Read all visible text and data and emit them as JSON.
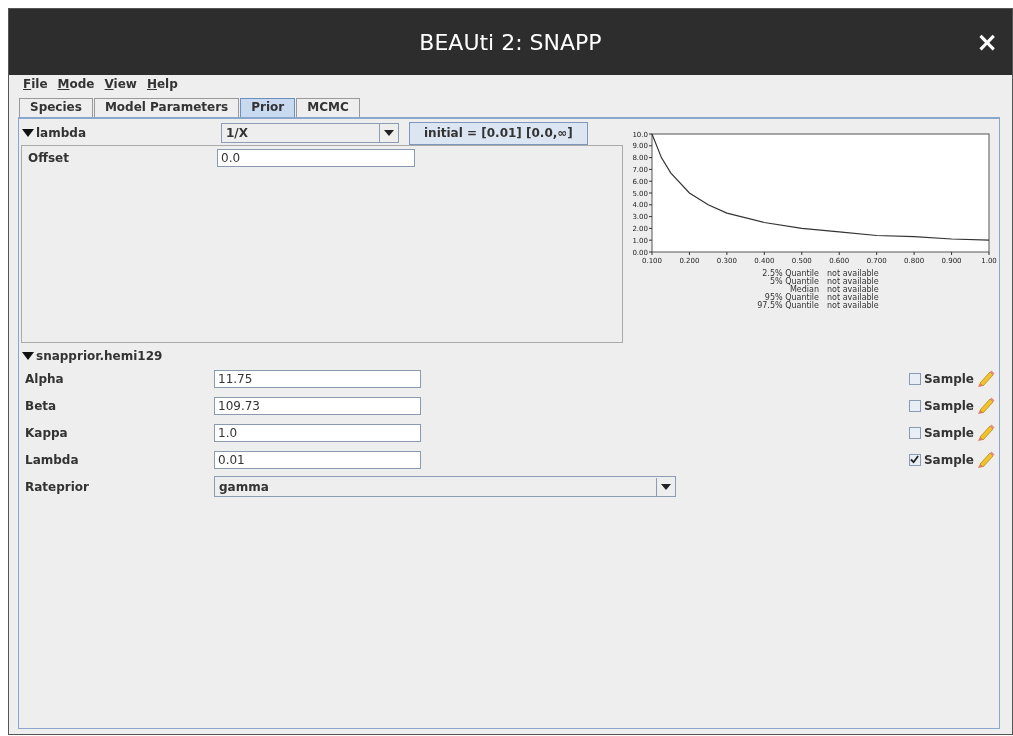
{
  "window": {
    "title": "BEAUti 2: SNAPP",
    "close": "×"
  },
  "menu": [
    "File",
    "Mode",
    "View",
    "Help"
  ],
  "tabs": [
    {
      "label": "Species",
      "selected": false
    },
    {
      "label": "Model Parameters",
      "selected": false
    },
    {
      "label": "Prior",
      "selected": true
    },
    {
      "label": "MCMC",
      "selected": false
    }
  ],
  "prior": {
    "name": "lambda",
    "expanded": true,
    "distribution": "1/X",
    "initial": "initial = [0.01] [0.0,∞]",
    "params": [
      {
        "label": "Offset",
        "value": "0.0"
      }
    ],
    "chart_data": {
      "type": "line",
      "x": [
        0.1,
        0.125,
        0.15,
        0.2,
        0.25,
        0.3,
        0.4,
        0.5,
        0.6,
        0.7,
        0.8,
        0.9,
        1.0
      ],
      "series": [
        {
          "color": "#333333",
          "values": [
            10,
            8,
            6.7,
            5,
            4,
            3.3,
            2.5,
            2,
            1.7,
            1.4,
            1.3,
            1.1,
            1
          ]
        }
      ],
      "xlim": [
        0.1,
        1.0
      ],
      "ylim": [
        0,
        10
      ],
      "xticks": [
        {
          "value": 0.1,
          "label": "0.100"
        },
        {
          "value": 0.2,
          "label": "0.200"
        },
        {
          "value": 0.3,
          "label": "0.300"
        },
        {
          "value": 0.4,
          "label": "0.400"
        },
        {
          "value": 0.5,
          "label": "0.500"
        },
        {
          "value": 0.6,
          "label": "0.600"
        },
        {
          "value": 0.7,
          "label": "0.700"
        },
        {
          "value": 0.8,
          "label": "0.800"
        },
        {
          "value": 0.9,
          "label": "0.900"
        },
        {
          "value": 1.0,
          "label": "1.00"
        }
      ],
      "yticks": [
        {
          "value": 0,
          "label": "0.00"
        },
        {
          "value": 1,
          "label": "1.00"
        },
        {
          "value": 2,
          "label": "2.00"
        },
        {
          "value": 3,
          "label": "3.00"
        },
        {
          "value": 4,
          "label": "4.00"
        },
        {
          "value": 5,
          "label": "5.00"
        },
        {
          "value": 6,
          "label": "6.00"
        },
        {
          "value": 7,
          "label": "7.00"
        },
        {
          "value": 8,
          "label": "8.00"
        },
        {
          "value": 9,
          "label": "9.00"
        },
        {
          "value": 10,
          "label": "10.0"
        }
      ]
    },
    "quantiles": [
      {
        "label": "2.5% Quantile",
        "value": "not available"
      },
      {
        "label": "5% Quantile",
        "value": "not available"
      },
      {
        "label": "Median",
        "value": "not available"
      },
      {
        "label": "95% Quantile",
        "value": "not available"
      },
      {
        "label": "97.5% Quantile",
        "value": "not available"
      }
    ]
  },
  "snapprior": {
    "name": "snapprior.hemi129",
    "expanded": true,
    "params": [
      {
        "kind": "number",
        "label": "Alpha",
        "value": "11.75",
        "sample_label": "Sample",
        "sample": false
      },
      {
        "kind": "number",
        "label": "Beta",
        "value": "109.73",
        "sample_label": "Sample",
        "sample": false
      },
      {
        "kind": "number",
        "label": "Kappa",
        "value": "1.0",
        "sample_label": "Sample",
        "sample": false
      },
      {
        "kind": "number",
        "label": "Lambda",
        "value": "0.01",
        "sample_label": "Sample",
        "sample": true
      },
      {
        "kind": "choice",
        "label": "Rateprior",
        "value": "gamma"
      }
    ]
  }
}
